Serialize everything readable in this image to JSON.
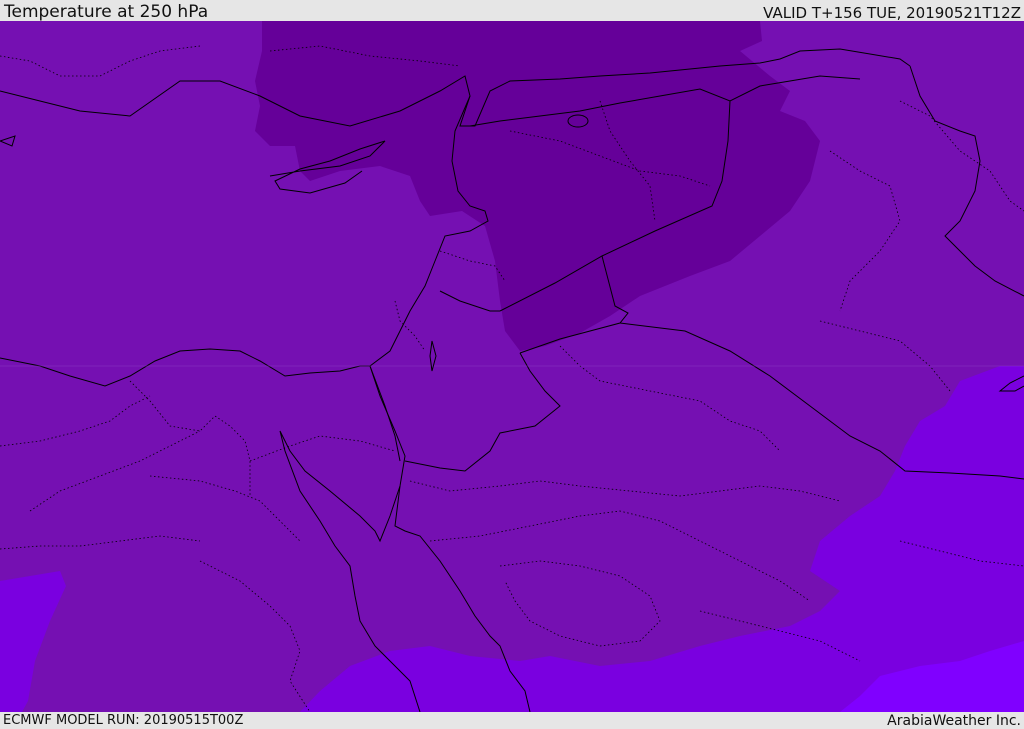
{
  "header": {
    "title": "Temperature at 250 hPa",
    "valid_time": "VALID T+156 TUE, 20190521T12Z"
  },
  "footer": {
    "model_run": "ECMWF MODEL RUN: 20190515T00Z",
    "credit": "ArabiaWeather Inc."
  },
  "colors": {
    "base_fill": "#7510b2",
    "cold_zone": "#650099",
    "warm_zone": "#7a00e0",
    "warmest_zone": "#8000ff",
    "border_line": "#000000"
  }
}
